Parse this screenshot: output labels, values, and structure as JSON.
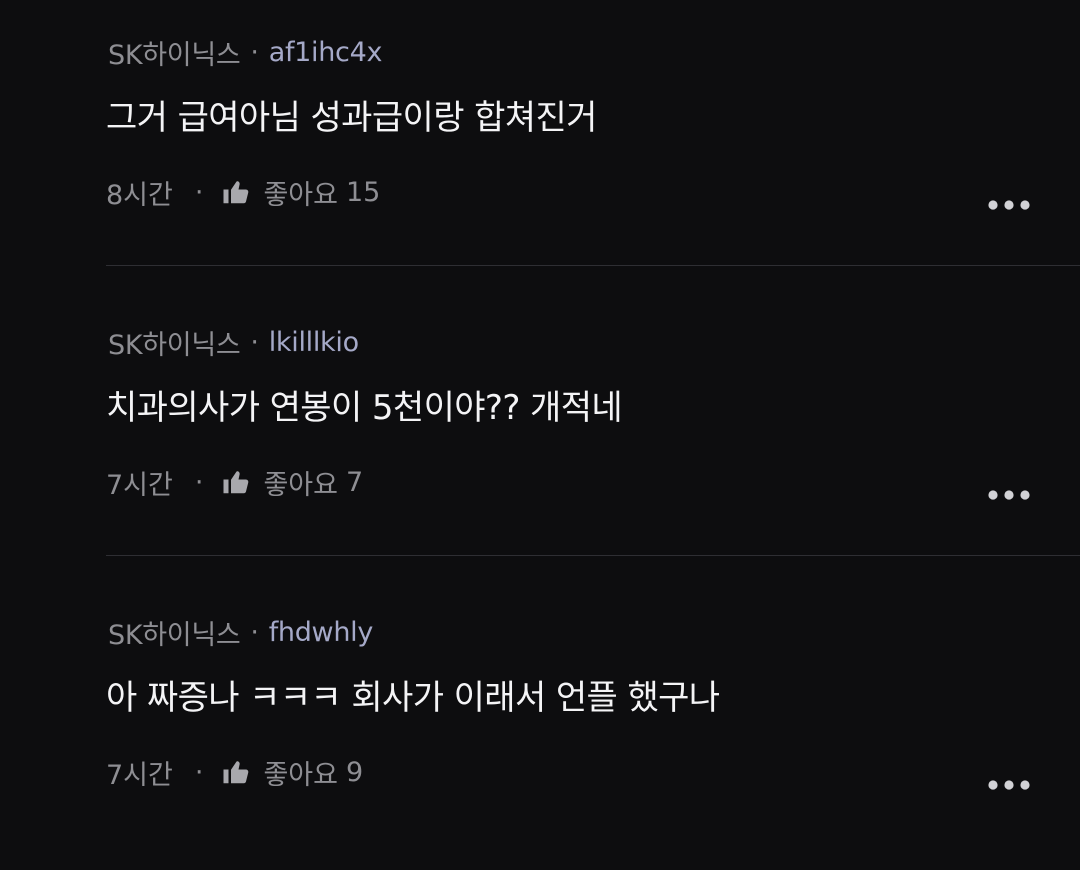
{
  "comments": [
    {
      "company": "SK하이닉스",
      "separator": "·",
      "author": "af1ihc4x",
      "text": "그거 급여아님 성과급이랑 합쳐진거",
      "time": "8시간",
      "footer_separator": "·",
      "like_label": "좋아요",
      "like_count": "15",
      "more_icon": "more-horizontal-icon",
      "like_icon": "thumbs-up-icon"
    },
    {
      "company": "SK하이닉스",
      "separator": "·",
      "author": "lkilllkio",
      "text": "치과의사가 연봉이 5천이야?? 개적네",
      "time": "7시간",
      "footer_separator": "·",
      "like_label": "좋아요",
      "like_count": "7",
      "more_icon": "more-horizontal-icon",
      "like_icon": "thumbs-up-icon"
    },
    {
      "company": "SK하이닉스",
      "separator": "·",
      "author": "fhdwhly",
      "text": "아 짜증나 ㅋㅋㅋ 회사가 이래서 언플 했구나",
      "time": "7시간",
      "footer_separator": "·",
      "like_label": "좋아요",
      "like_count": "9",
      "more_icon": "more-horizontal-icon",
      "like_icon": "thumbs-up-icon"
    }
  ],
  "colors": {
    "background": "#0d0d0f",
    "company": "#8e8e93",
    "author": "#a5a9c8",
    "text": "#f4f4f6",
    "meta": "#8e8e93",
    "icon": "#a8a8ad",
    "divider": "#2e2e33"
  }
}
